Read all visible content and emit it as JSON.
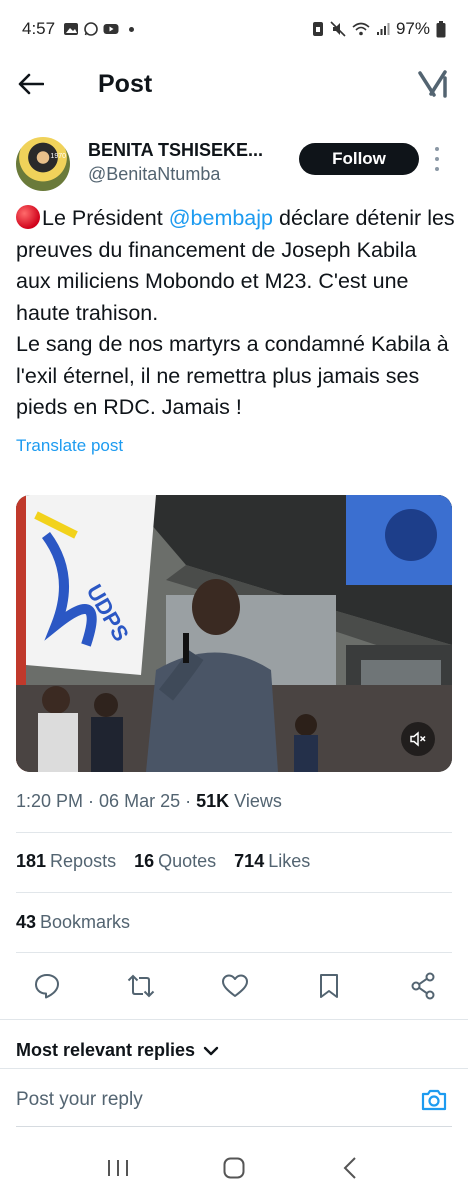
{
  "status_bar": {
    "time": "4:57",
    "battery": "97%"
  },
  "header": {
    "title": "Post"
  },
  "author": {
    "name": "BENITA TSHISEKE...",
    "handle": "@BenitaNtumba",
    "avatar_year": "1970",
    "follow_label": "Follow"
  },
  "tweet": {
    "text_before_mention": "Le Président ",
    "mention": "@bembajp",
    "text_after_mention": " déclare détenir les preuves du financement de Joseph Kabila aux miliciens Mobondo et M23. C'est une haute trahison.",
    "text_second_paragraph": "Le sang de nos martyrs a condamné Kabila à l'exil éternel, il ne remettra plus jamais ses pieds en RDC. Jamais !",
    "translate_label": "Translate post"
  },
  "meta": {
    "time": "1:20 PM",
    "date": "06 Mar 25",
    "views_count": "51K",
    "views_label": "Views"
  },
  "stats": {
    "reposts_count": "181",
    "reposts_label": "Reposts",
    "quotes_count": "16",
    "quotes_label": "Quotes",
    "likes_count": "714",
    "likes_label": "Likes",
    "bookmarks_count": "43",
    "bookmarks_label": "Bookmarks"
  },
  "replies": {
    "sort_label": "Most relevant replies",
    "input_placeholder": "Post your reply"
  },
  "icons": {
    "accent": "#1d9bf0",
    "action_icon_color": "#536471"
  }
}
